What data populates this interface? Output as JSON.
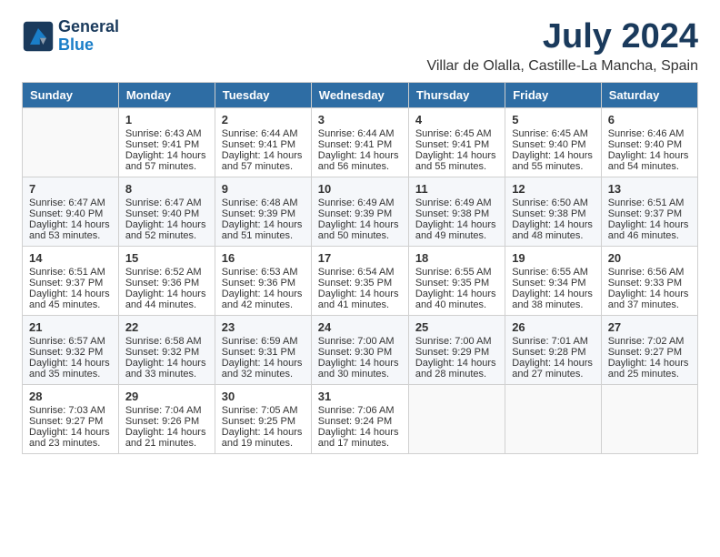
{
  "header": {
    "logo_line1": "General",
    "logo_line2": "Blue",
    "month_year": "July 2024",
    "location": "Villar de Olalla, Castille-La Mancha, Spain"
  },
  "days_of_week": [
    "Sunday",
    "Monday",
    "Tuesday",
    "Wednesday",
    "Thursday",
    "Friday",
    "Saturday"
  ],
  "weeks": [
    [
      {
        "day": "",
        "info": ""
      },
      {
        "day": "1",
        "info": "Sunrise: 6:43 AM\nSunset: 9:41 PM\nDaylight: 14 hours\nand 57 minutes."
      },
      {
        "day": "2",
        "info": "Sunrise: 6:44 AM\nSunset: 9:41 PM\nDaylight: 14 hours\nand 57 minutes."
      },
      {
        "day": "3",
        "info": "Sunrise: 6:44 AM\nSunset: 9:41 PM\nDaylight: 14 hours\nand 56 minutes."
      },
      {
        "day": "4",
        "info": "Sunrise: 6:45 AM\nSunset: 9:41 PM\nDaylight: 14 hours\nand 55 minutes."
      },
      {
        "day": "5",
        "info": "Sunrise: 6:45 AM\nSunset: 9:40 PM\nDaylight: 14 hours\nand 55 minutes."
      },
      {
        "day": "6",
        "info": "Sunrise: 6:46 AM\nSunset: 9:40 PM\nDaylight: 14 hours\nand 54 minutes."
      }
    ],
    [
      {
        "day": "7",
        "info": "Sunrise: 6:47 AM\nSunset: 9:40 PM\nDaylight: 14 hours\nand 53 minutes."
      },
      {
        "day": "8",
        "info": "Sunrise: 6:47 AM\nSunset: 9:40 PM\nDaylight: 14 hours\nand 52 minutes."
      },
      {
        "day": "9",
        "info": "Sunrise: 6:48 AM\nSunset: 9:39 PM\nDaylight: 14 hours\nand 51 minutes."
      },
      {
        "day": "10",
        "info": "Sunrise: 6:49 AM\nSunset: 9:39 PM\nDaylight: 14 hours\nand 50 minutes."
      },
      {
        "day": "11",
        "info": "Sunrise: 6:49 AM\nSunset: 9:38 PM\nDaylight: 14 hours\nand 49 minutes."
      },
      {
        "day": "12",
        "info": "Sunrise: 6:50 AM\nSunset: 9:38 PM\nDaylight: 14 hours\nand 48 minutes."
      },
      {
        "day": "13",
        "info": "Sunrise: 6:51 AM\nSunset: 9:37 PM\nDaylight: 14 hours\nand 46 minutes."
      }
    ],
    [
      {
        "day": "14",
        "info": "Sunrise: 6:51 AM\nSunset: 9:37 PM\nDaylight: 14 hours\nand 45 minutes."
      },
      {
        "day": "15",
        "info": "Sunrise: 6:52 AM\nSunset: 9:36 PM\nDaylight: 14 hours\nand 44 minutes."
      },
      {
        "day": "16",
        "info": "Sunrise: 6:53 AM\nSunset: 9:36 PM\nDaylight: 14 hours\nand 42 minutes."
      },
      {
        "day": "17",
        "info": "Sunrise: 6:54 AM\nSunset: 9:35 PM\nDaylight: 14 hours\nand 41 minutes."
      },
      {
        "day": "18",
        "info": "Sunrise: 6:55 AM\nSunset: 9:35 PM\nDaylight: 14 hours\nand 40 minutes."
      },
      {
        "day": "19",
        "info": "Sunrise: 6:55 AM\nSunset: 9:34 PM\nDaylight: 14 hours\nand 38 minutes."
      },
      {
        "day": "20",
        "info": "Sunrise: 6:56 AM\nSunset: 9:33 PM\nDaylight: 14 hours\nand 37 minutes."
      }
    ],
    [
      {
        "day": "21",
        "info": "Sunrise: 6:57 AM\nSunset: 9:32 PM\nDaylight: 14 hours\nand 35 minutes."
      },
      {
        "day": "22",
        "info": "Sunrise: 6:58 AM\nSunset: 9:32 PM\nDaylight: 14 hours\nand 33 minutes."
      },
      {
        "day": "23",
        "info": "Sunrise: 6:59 AM\nSunset: 9:31 PM\nDaylight: 14 hours\nand 32 minutes."
      },
      {
        "day": "24",
        "info": "Sunrise: 7:00 AM\nSunset: 9:30 PM\nDaylight: 14 hours\nand 30 minutes."
      },
      {
        "day": "25",
        "info": "Sunrise: 7:00 AM\nSunset: 9:29 PM\nDaylight: 14 hours\nand 28 minutes."
      },
      {
        "day": "26",
        "info": "Sunrise: 7:01 AM\nSunset: 9:28 PM\nDaylight: 14 hours\nand 27 minutes."
      },
      {
        "day": "27",
        "info": "Sunrise: 7:02 AM\nSunset: 9:27 PM\nDaylight: 14 hours\nand 25 minutes."
      }
    ],
    [
      {
        "day": "28",
        "info": "Sunrise: 7:03 AM\nSunset: 9:27 PM\nDaylight: 14 hours\nand 23 minutes."
      },
      {
        "day": "29",
        "info": "Sunrise: 7:04 AM\nSunset: 9:26 PM\nDaylight: 14 hours\nand 21 minutes."
      },
      {
        "day": "30",
        "info": "Sunrise: 7:05 AM\nSunset: 9:25 PM\nDaylight: 14 hours\nand 19 minutes."
      },
      {
        "day": "31",
        "info": "Sunrise: 7:06 AM\nSunset: 9:24 PM\nDaylight: 14 hours\nand 17 minutes."
      },
      {
        "day": "",
        "info": ""
      },
      {
        "day": "",
        "info": ""
      },
      {
        "day": "",
        "info": ""
      }
    ]
  ]
}
